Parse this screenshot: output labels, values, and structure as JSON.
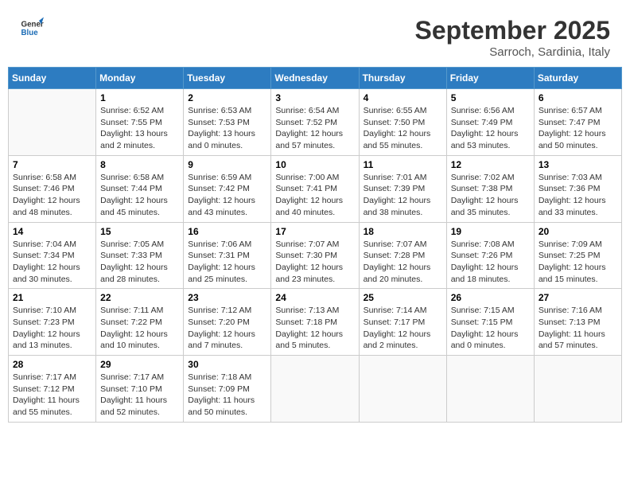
{
  "logo": {
    "line1": "General",
    "line2": "Blue"
  },
  "title": "September 2025",
  "subtitle": "Sarroch, Sardinia, Italy",
  "days_of_week": [
    "Sunday",
    "Monday",
    "Tuesday",
    "Wednesday",
    "Thursday",
    "Friday",
    "Saturday"
  ],
  "weeks": [
    [
      {
        "num": "",
        "info": ""
      },
      {
        "num": "1",
        "info": "Sunrise: 6:52 AM\nSunset: 7:55 PM\nDaylight: 13 hours\nand 2 minutes."
      },
      {
        "num": "2",
        "info": "Sunrise: 6:53 AM\nSunset: 7:53 PM\nDaylight: 13 hours\nand 0 minutes."
      },
      {
        "num": "3",
        "info": "Sunrise: 6:54 AM\nSunset: 7:52 PM\nDaylight: 12 hours\nand 57 minutes."
      },
      {
        "num": "4",
        "info": "Sunrise: 6:55 AM\nSunset: 7:50 PM\nDaylight: 12 hours\nand 55 minutes."
      },
      {
        "num": "5",
        "info": "Sunrise: 6:56 AM\nSunset: 7:49 PM\nDaylight: 12 hours\nand 53 minutes."
      },
      {
        "num": "6",
        "info": "Sunrise: 6:57 AM\nSunset: 7:47 PM\nDaylight: 12 hours\nand 50 minutes."
      }
    ],
    [
      {
        "num": "7",
        "info": "Sunrise: 6:58 AM\nSunset: 7:46 PM\nDaylight: 12 hours\nand 48 minutes."
      },
      {
        "num": "8",
        "info": "Sunrise: 6:58 AM\nSunset: 7:44 PM\nDaylight: 12 hours\nand 45 minutes."
      },
      {
        "num": "9",
        "info": "Sunrise: 6:59 AM\nSunset: 7:42 PM\nDaylight: 12 hours\nand 43 minutes."
      },
      {
        "num": "10",
        "info": "Sunrise: 7:00 AM\nSunset: 7:41 PM\nDaylight: 12 hours\nand 40 minutes."
      },
      {
        "num": "11",
        "info": "Sunrise: 7:01 AM\nSunset: 7:39 PM\nDaylight: 12 hours\nand 38 minutes."
      },
      {
        "num": "12",
        "info": "Sunrise: 7:02 AM\nSunset: 7:38 PM\nDaylight: 12 hours\nand 35 minutes."
      },
      {
        "num": "13",
        "info": "Sunrise: 7:03 AM\nSunset: 7:36 PM\nDaylight: 12 hours\nand 33 minutes."
      }
    ],
    [
      {
        "num": "14",
        "info": "Sunrise: 7:04 AM\nSunset: 7:34 PM\nDaylight: 12 hours\nand 30 minutes."
      },
      {
        "num": "15",
        "info": "Sunrise: 7:05 AM\nSunset: 7:33 PM\nDaylight: 12 hours\nand 28 minutes."
      },
      {
        "num": "16",
        "info": "Sunrise: 7:06 AM\nSunset: 7:31 PM\nDaylight: 12 hours\nand 25 minutes."
      },
      {
        "num": "17",
        "info": "Sunrise: 7:07 AM\nSunset: 7:30 PM\nDaylight: 12 hours\nand 23 minutes."
      },
      {
        "num": "18",
        "info": "Sunrise: 7:07 AM\nSunset: 7:28 PM\nDaylight: 12 hours\nand 20 minutes."
      },
      {
        "num": "19",
        "info": "Sunrise: 7:08 AM\nSunset: 7:26 PM\nDaylight: 12 hours\nand 18 minutes."
      },
      {
        "num": "20",
        "info": "Sunrise: 7:09 AM\nSunset: 7:25 PM\nDaylight: 12 hours\nand 15 minutes."
      }
    ],
    [
      {
        "num": "21",
        "info": "Sunrise: 7:10 AM\nSunset: 7:23 PM\nDaylight: 12 hours\nand 13 minutes."
      },
      {
        "num": "22",
        "info": "Sunrise: 7:11 AM\nSunset: 7:22 PM\nDaylight: 12 hours\nand 10 minutes."
      },
      {
        "num": "23",
        "info": "Sunrise: 7:12 AM\nSunset: 7:20 PM\nDaylight: 12 hours\nand 7 minutes."
      },
      {
        "num": "24",
        "info": "Sunrise: 7:13 AM\nSunset: 7:18 PM\nDaylight: 12 hours\nand 5 minutes."
      },
      {
        "num": "25",
        "info": "Sunrise: 7:14 AM\nSunset: 7:17 PM\nDaylight: 12 hours\nand 2 minutes."
      },
      {
        "num": "26",
        "info": "Sunrise: 7:15 AM\nSunset: 7:15 PM\nDaylight: 12 hours\nand 0 minutes."
      },
      {
        "num": "27",
        "info": "Sunrise: 7:16 AM\nSunset: 7:13 PM\nDaylight: 11 hours\nand 57 minutes."
      }
    ],
    [
      {
        "num": "28",
        "info": "Sunrise: 7:17 AM\nSunset: 7:12 PM\nDaylight: 11 hours\nand 55 minutes."
      },
      {
        "num": "29",
        "info": "Sunrise: 7:17 AM\nSunset: 7:10 PM\nDaylight: 11 hours\nand 52 minutes."
      },
      {
        "num": "30",
        "info": "Sunrise: 7:18 AM\nSunset: 7:09 PM\nDaylight: 11 hours\nand 50 minutes."
      },
      {
        "num": "",
        "info": ""
      },
      {
        "num": "",
        "info": ""
      },
      {
        "num": "",
        "info": ""
      },
      {
        "num": "",
        "info": ""
      }
    ]
  ]
}
